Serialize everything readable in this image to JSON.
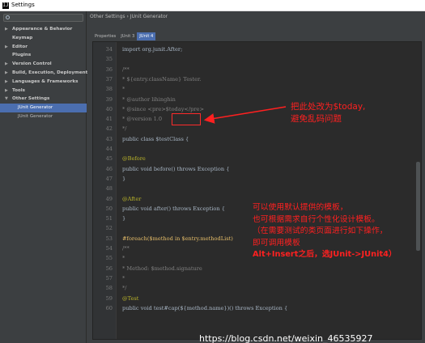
{
  "window": {
    "title": "Settings",
    "app_icon": "IJ"
  },
  "sidebar": {
    "items": [
      {
        "label": "Appearance & Behavior",
        "arrow": "▶",
        "type": "parent"
      },
      {
        "label": "Keymap",
        "arrow": "",
        "type": "parent"
      },
      {
        "label": "Editor",
        "arrow": "▶",
        "type": "parent"
      },
      {
        "label": "Plugins",
        "arrow": "",
        "type": "parent"
      },
      {
        "label": "Version Control",
        "arrow": "▶",
        "type": "parent"
      },
      {
        "label": "Build, Execution, Deployment",
        "arrow": "▶",
        "type": "parent"
      },
      {
        "label": "Languages & Frameworks",
        "arrow": "▶",
        "type": "parent"
      },
      {
        "label": "Tools",
        "arrow": "▶",
        "type": "parent"
      },
      {
        "label": "Other Settings",
        "arrow": "▼",
        "type": "parent"
      },
      {
        "label": "JUnit Generator",
        "arrow": "",
        "type": "child",
        "selected": true
      },
      {
        "label": "JUnit Generator",
        "arrow": "",
        "type": "child"
      }
    ]
  },
  "breadcrumb": "Other Settings › JUnit Generator",
  "tabs": [
    {
      "label": "Properties"
    },
    {
      "label": "JUnit 3"
    },
    {
      "label": "JUnit 4",
      "active": true
    }
  ],
  "editor": {
    "lines": [
      {
        "n": "34",
        "text": "import org.junit.After;"
      },
      {
        "n": "35",
        "text": ""
      },
      {
        "n": "36",
        "text": "/**"
      },
      {
        "n": "37",
        "text": "* ${entry.className} Tester."
      },
      {
        "n": "38",
        "text": "*"
      },
      {
        "n": "39",
        "text": "* @author lihinghin"
      },
      {
        "n": "40",
        "text": "* @since <pre>$today</pre>"
      },
      {
        "n": "41",
        "text": "* @version 1.0"
      },
      {
        "n": "42",
        "text": "*/"
      },
      {
        "n": "43",
        "text": "public class $testClass {"
      },
      {
        "n": "44",
        "text": ""
      },
      {
        "n": "45",
        "text": "@Before"
      },
      {
        "n": "46",
        "text": "public void before() throws Exception {"
      },
      {
        "n": "47",
        "text": "}"
      },
      {
        "n": "48",
        "text": ""
      },
      {
        "n": "49",
        "text": "@After"
      },
      {
        "n": "50",
        "text": "public void after() throws Exception {"
      },
      {
        "n": "51",
        "text": "}"
      },
      {
        "n": "52",
        "text": ""
      },
      {
        "n": "53",
        "text": "#foreach($method in $entry.methodList)"
      },
      {
        "n": "54",
        "text": "/**"
      },
      {
        "n": "55",
        "text": "*"
      },
      {
        "n": "56",
        "text": "* Method: $method.signature"
      },
      {
        "n": "57",
        "text": "*"
      },
      {
        "n": "58",
        "text": "*/"
      },
      {
        "n": "59",
        "text": "@Test"
      },
      {
        "n": "60",
        "text": "public void test#cap(${method.name})() throws Exception {"
      }
    ]
  },
  "annotations": {
    "note1": [
      "把此处改为$today,",
      "避免乱码问题"
    ],
    "note2": [
      "可以使用默认提供的模板，",
      "也可根据需求自行个性化设计模板。",
      "（在需要测试的类页面进行如下操作，",
      "即可调用模板",
      "Alt+Insert之后，选JUnit->JUnit4）"
    ]
  },
  "watermark": "https://blog.csdn.net/weixin_46535927",
  "colors": {
    "background": "#3c3f41",
    "editor_bg": "#2b2b2b",
    "selection": "#4b6eaf",
    "annotation_red": "#ff2020"
  }
}
